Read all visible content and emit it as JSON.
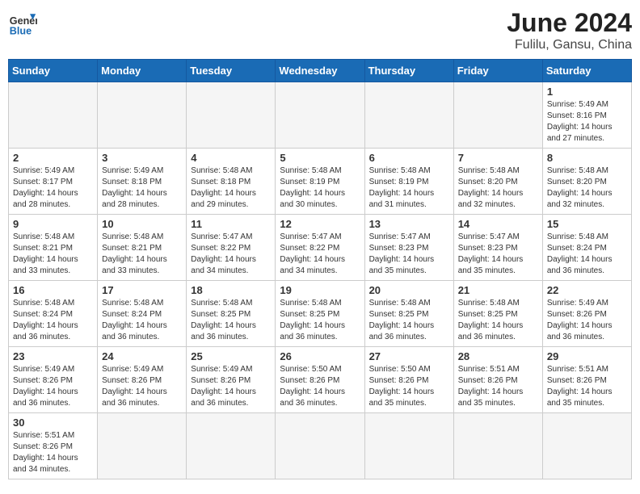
{
  "header": {
    "logo_general": "General",
    "logo_blue": "Blue",
    "month_year": "June 2024",
    "location": "Fulilu, Gansu, China"
  },
  "weekdays": [
    "Sunday",
    "Monday",
    "Tuesday",
    "Wednesday",
    "Thursday",
    "Friday",
    "Saturday"
  ],
  "weeks": [
    [
      {
        "day": "",
        "info": ""
      },
      {
        "day": "",
        "info": ""
      },
      {
        "day": "",
        "info": ""
      },
      {
        "day": "",
        "info": ""
      },
      {
        "day": "",
        "info": ""
      },
      {
        "day": "",
        "info": ""
      },
      {
        "day": "1",
        "info": "Sunrise: 5:49 AM\nSunset: 8:16 PM\nDaylight: 14 hours and 27 minutes."
      }
    ],
    [
      {
        "day": "2",
        "info": "Sunrise: 5:49 AM\nSunset: 8:17 PM\nDaylight: 14 hours and 28 minutes."
      },
      {
        "day": "3",
        "info": "Sunrise: 5:49 AM\nSunset: 8:18 PM\nDaylight: 14 hours and 28 minutes."
      },
      {
        "day": "4",
        "info": "Sunrise: 5:48 AM\nSunset: 8:18 PM\nDaylight: 14 hours and 29 minutes."
      },
      {
        "day": "5",
        "info": "Sunrise: 5:48 AM\nSunset: 8:19 PM\nDaylight: 14 hours and 30 minutes."
      },
      {
        "day": "6",
        "info": "Sunrise: 5:48 AM\nSunset: 8:19 PM\nDaylight: 14 hours and 31 minutes."
      },
      {
        "day": "7",
        "info": "Sunrise: 5:48 AM\nSunset: 8:20 PM\nDaylight: 14 hours and 32 minutes."
      },
      {
        "day": "8",
        "info": "Sunrise: 5:48 AM\nSunset: 8:20 PM\nDaylight: 14 hours and 32 minutes."
      }
    ],
    [
      {
        "day": "9",
        "info": "Sunrise: 5:48 AM\nSunset: 8:21 PM\nDaylight: 14 hours and 33 minutes."
      },
      {
        "day": "10",
        "info": "Sunrise: 5:48 AM\nSunset: 8:21 PM\nDaylight: 14 hours and 33 minutes."
      },
      {
        "day": "11",
        "info": "Sunrise: 5:47 AM\nSunset: 8:22 PM\nDaylight: 14 hours and 34 minutes."
      },
      {
        "day": "12",
        "info": "Sunrise: 5:47 AM\nSunset: 8:22 PM\nDaylight: 14 hours and 34 minutes."
      },
      {
        "day": "13",
        "info": "Sunrise: 5:47 AM\nSunset: 8:23 PM\nDaylight: 14 hours and 35 minutes."
      },
      {
        "day": "14",
        "info": "Sunrise: 5:47 AM\nSunset: 8:23 PM\nDaylight: 14 hours and 35 minutes."
      },
      {
        "day": "15",
        "info": "Sunrise: 5:48 AM\nSunset: 8:24 PM\nDaylight: 14 hours and 36 minutes."
      }
    ],
    [
      {
        "day": "16",
        "info": "Sunrise: 5:48 AM\nSunset: 8:24 PM\nDaylight: 14 hours and 36 minutes."
      },
      {
        "day": "17",
        "info": "Sunrise: 5:48 AM\nSunset: 8:24 PM\nDaylight: 14 hours and 36 minutes."
      },
      {
        "day": "18",
        "info": "Sunrise: 5:48 AM\nSunset: 8:25 PM\nDaylight: 14 hours and 36 minutes."
      },
      {
        "day": "19",
        "info": "Sunrise: 5:48 AM\nSunset: 8:25 PM\nDaylight: 14 hours and 36 minutes."
      },
      {
        "day": "20",
        "info": "Sunrise: 5:48 AM\nSunset: 8:25 PM\nDaylight: 14 hours and 36 minutes."
      },
      {
        "day": "21",
        "info": "Sunrise: 5:48 AM\nSunset: 8:25 PM\nDaylight: 14 hours and 36 minutes."
      },
      {
        "day": "22",
        "info": "Sunrise: 5:49 AM\nSunset: 8:26 PM\nDaylight: 14 hours and 36 minutes."
      }
    ],
    [
      {
        "day": "23",
        "info": "Sunrise: 5:49 AM\nSunset: 8:26 PM\nDaylight: 14 hours and 36 minutes."
      },
      {
        "day": "24",
        "info": "Sunrise: 5:49 AM\nSunset: 8:26 PM\nDaylight: 14 hours and 36 minutes."
      },
      {
        "day": "25",
        "info": "Sunrise: 5:49 AM\nSunset: 8:26 PM\nDaylight: 14 hours and 36 minutes."
      },
      {
        "day": "26",
        "info": "Sunrise: 5:50 AM\nSunset: 8:26 PM\nDaylight: 14 hours and 36 minutes."
      },
      {
        "day": "27",
        "info": "Sunrise: 5:50 AM\nSunset: 8:26 PM\nDaylight: 14 hours and 35 minutes."
      },
      {
        "day": "28",
        "info": "Sunrise: 5:51 AM\nSunset: 8:26 PM\nDaylight: 14 hours and 35 minutes."
      },
      {
        "day": "29",
        "info": "Sunrise: 5:51 AM\nSunset: 8:26 PM\nDaylight: 14 hours and 35 minutes."
      }
    ],
    [
      {
        "day": "30",
        "info": "Sunrise: 5:51 AM\nSunset: 8:26 PM\nDaylight: 14 hours and 34 minutes."
      },
      {
        "day": "",
        "info": ""
      },
      {
        "day": "",
        "info": ""
      },
      {
        "day": "",
        "info": ""
      },
      {
        "day": "",
        "info": ""
      },
      {
        "day": "",
        "info": ""
      },
      {
        "day": "",
        "info": ""
      }
    ]
  ]
}
